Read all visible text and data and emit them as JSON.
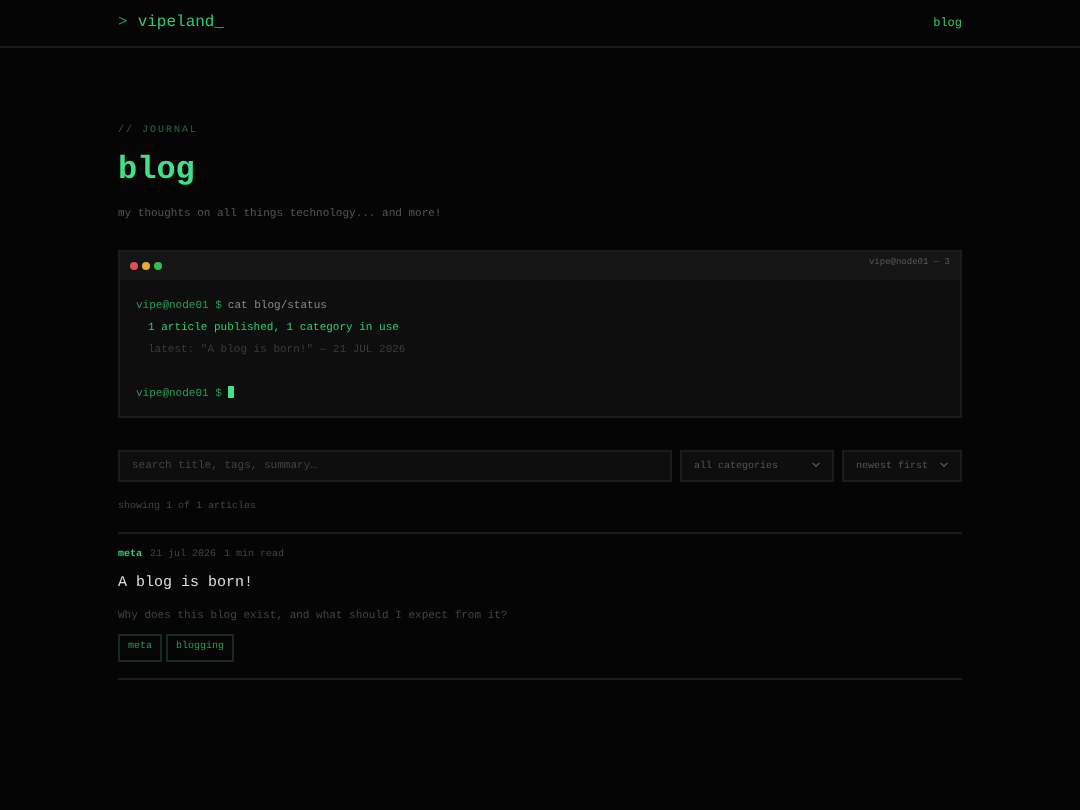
{
  "header": {
    "prompt": ">",
    "logo": "vipeland_",
    "nav": [
      {
        "label": "blog",
        "selected": true
      }
    ]
  },
  "eyebrow": "// JOURNAL",
  "title": "blog",
  "subtitle": "my thoughts on all things technology... and more!",
  "terminal": {
    "title": "vipe@node01 — 3",
    "lines": [
      {
        "kind": "command",
        "prompt": "vipe@node01 $",
        "text": "cat blog/status"
      },
      {
        "kind": "output",
        "text": "1 article published, 1 category in use"
      },
      {
        "kind": "muted",
        "text": "latest: \"A blog is born!\" — 21 JUL 2026"
      },
      {
        "kind": "cursor",
        "prompt": "vipe@node01 $"
      }
    ]
  },
  "search": {
    "placeholder": "search title, tags, summary…"
  },
  "filters": [
    {
      "value": "all categories"
    },
    {
      "value": "newest first"
    }
  ],
  "count": "showing 1 of 1 articles",
  "posts": [
    {
      "category": "meta",
      "date": "21 jul 2026",
      "read_time": "1 min read",
      "title": "A blog is born!",
      "summary": "Why does this blog exist, and what should I expect from it?",
      "tags": [
        "meta",
        "blogging"
      ]
    }
  ]
}
